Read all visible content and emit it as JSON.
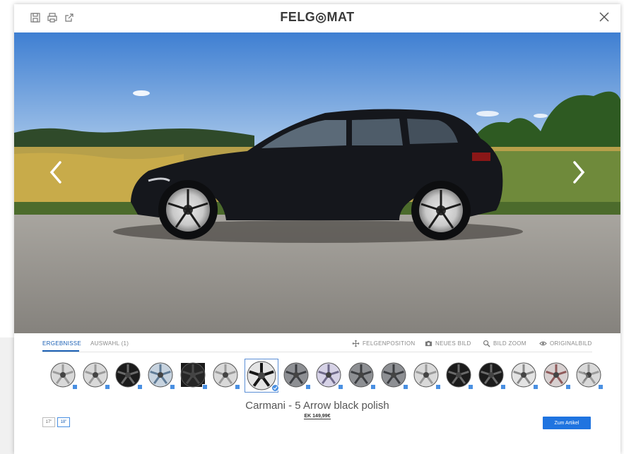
{
  "header": {
    "logo_text": "FELG◎MAT",
    "icons": [
      "save-icon",
      "print-icon",
      "external-link-icon",
      "close-icon"
    ]
  },
  "tabs": [
    {
      "label": "ERGEBNISSE",
      "active": true
    },
    {
      "label": "AUSWAHL (1)",
      "active": false
    }
  ],
  "tools": [
    {
      "label": "FELGENPOSITION",
      "icon": "move-icon"
    },
    {
      "label": "NEUES BILD",
      "icon": "camera-icon"
    },
    {
      "label": "BILD ZOOM",
      "icon": "zoom-icon"
    },
    {
      "label": "ORIGINALBILD",
      "icon": "eye-icon"
    }
  ],
  "wheels": {
    "count": 17,
    "selected_index": 6,
    "styles": [
      "silver",
      "silver",
      "black",
      "silver-blue",
      "black-square",
      "silver",
      "black-polish",
      "gunmetal",
      "silver-violet",
      "gunmetal",
      "gunmetal",
      "silver",
      "black",
      "black",
      "silver-mesh",
      "silver-red",
      "silver"
    ]
  },
  "product": {
    "name": "Carmani - 5 Arrow black polish",
    "price": "EK 149,99€"
  },
  "sizes": [
    {
      "label": "17\"",
      "active": false
    },
    {
      "label": "18\"",
      "active": true
    }
  ],
  "cta": {
    "label": "Zum Artikel"
  },
  "colors": {
    "accent": "#1f74e0",
    "sky": "#5b93d8",
    "field": "#a8a24a",
    "road": "#8d8a85"
  }
}
